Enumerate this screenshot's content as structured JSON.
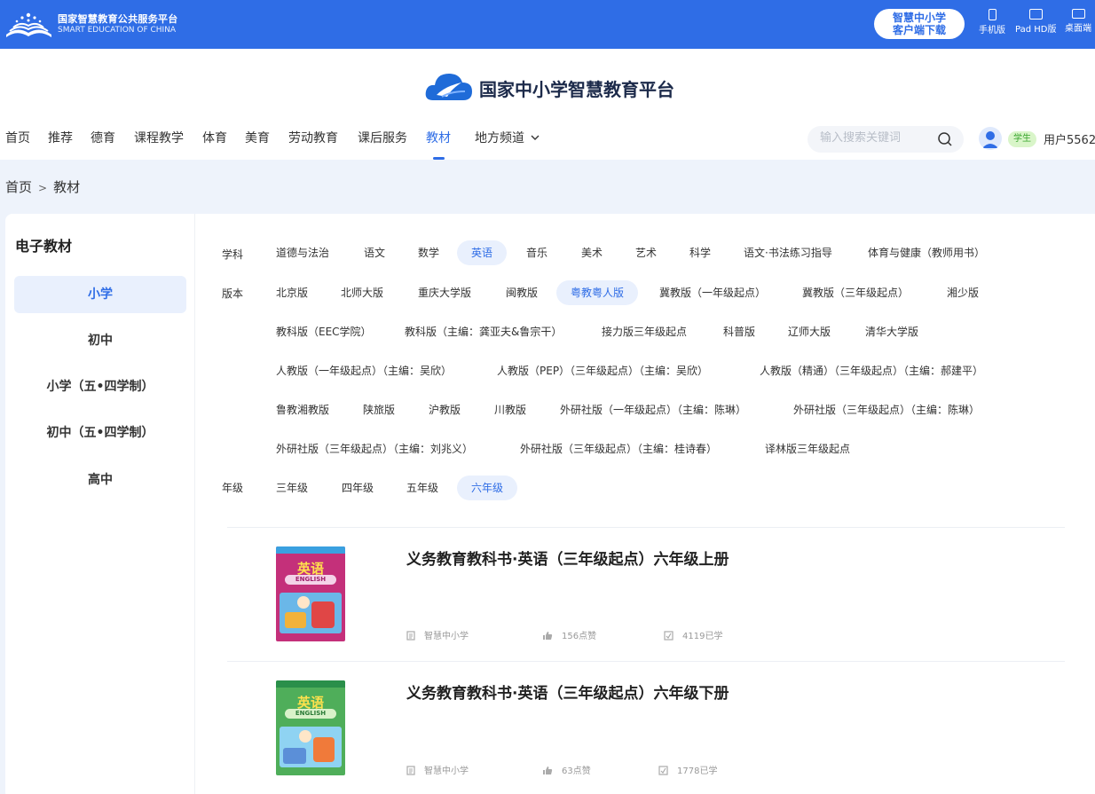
{
  "topbar": {
    "logo_cn": "国家智慧教育公共服务平台",
    "logo_en": "SMART EDUCATION OF CHINA",
    "download_line1": "智慧中小学",
    "download_line2": "客户端下载",
    "devices": [
      "手机版",
      "Pad HD版",
      "桌面端"
    ]
  },
  "brand": {
    "name": "国家中小学智慧教育平台"
  },
  "nav": {
    "items": [
      "首页",
      "推荐",
      "德育",
      "课程教学",
      "体育",
      "美育",
      "劳动教育",
      "课后服务",
      "教材",
      "地方频道"
    ],
    "active": "教材"
  },
  "search": {
    "placeholder": "输入搜索关键词"
  },
  "user": {
    "role": "学生",
    "name": "用户5562"
  },
  "breadcrumb": {
    "home": "首页",
    "sep": ">",
    "current": "教材"
  },
  "sidebar": {
    "title": "电子教材",
    "items": [
      "小学",
      "初中",
      "小学（五•四学制）",
      "初中（五•四学制）",
      "高中"
    ],
    "active": "小学"
  },
  "filters": {
    "subject_label": "学科",
    "subjects": [
      "道德与法治",
      "语文",
      "数学",
      "英语",
      "音乐",
      "美术",
      "艺术",
      "科学",
      "语文·书法练习指导",
      "体育与健康（教师用书）"
    ],
    "subject_selected": "英语",
    "edition_label": "版本",
    "editions_row1": [
      "北京版",
      "北师大版",
      "重庆大学版",
      "闽教版",
      "粤教粤人版",
      "冀教版（一年级起点）",
      "冀教版（三年级起点）",
      "湘少版"
    ],
    "editions_row2": [
      "教科版（EEC学院）",
      "教科版（主编：龚亚夫&鲁宗干）",
      "接力版三年级起点",
      "科普版",
      "辽师大版",
      "清华大学版"
    ],
    "editions_row3": [
      "人教版（一年级起点）（主编：吴欣）",
      "人教版（PEP）（三年级起点）（主编：吴欣）",
      "人教版（精通）（三年级起点）（主编：郝建平）"
    ],
    "editions_row4": [
      "鲁教湘教版",
      "陕旅版",
      "沪教版",
      "川教版",
      "外研社版（一年级起点）（主编：陈琳）",
      "外研社版（三年级起点）（主编：陈琳）"
    ],
    "editions_row5": [
      "外研社版（三年级起点）（主编：刘兆义）",
      "外研社版（三年级起点）（主编：桂诗春）",
      "译林版三年级起点"
    ],
    "edition_selected": "粤教粤人版",
    "grade_label": "年级",
    "grades": [
      "三年级",
      "四年级",
      "五年级",
      "六年级"
    ],
    "grade_selected": "六年级"
  },
  "books": [
    {
      "title": "义务教育教科书·英语（三年级起点）六年级上册",
      "publisher": "智慧中小学",
      "likes": "156点赞",
      "learners": "4119已学",
      "cover_text": "英语",
      "cover_en": "ENGLISH",
      "cover_color": "#c4307a"
    },
    {
      "title": "义务教育教科书·英语（三年级起点）六年级下册",
      "publisher": "智慧中小学",
      "likes": "63点赞",
      "learners": "1778已学",
      "cover_text": "英语",
      "cover_en": "ENGLISH",
      "cover_color": "#4fae5a"
    }
  ]
}
